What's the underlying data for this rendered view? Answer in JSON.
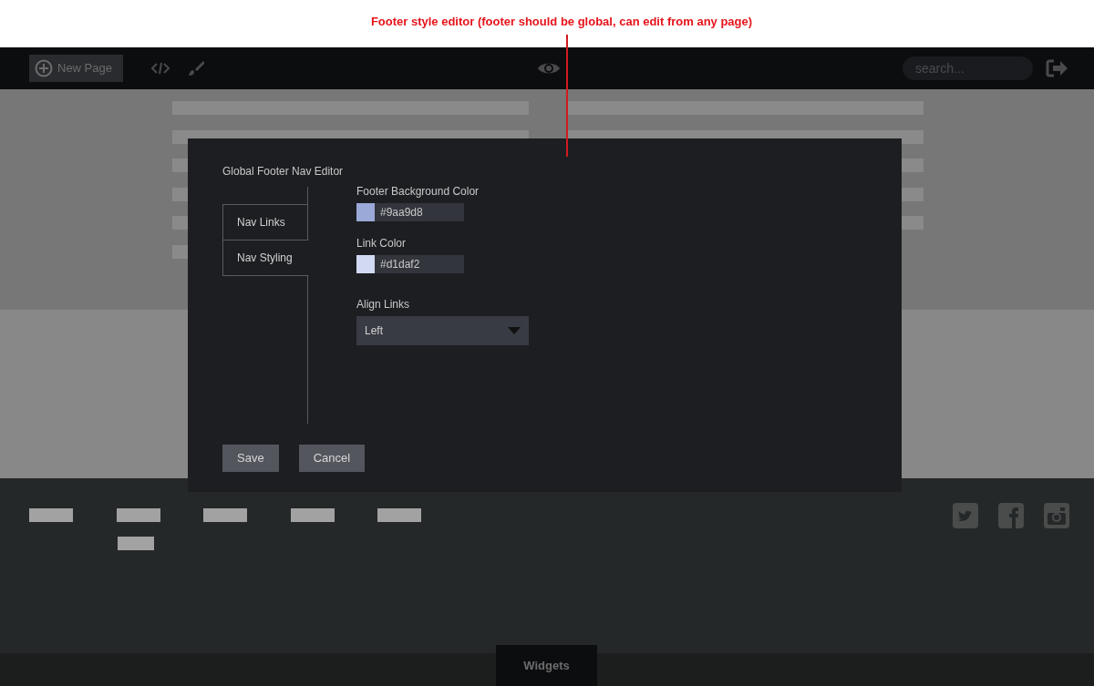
{
  "annotation": "Footer style editor (footer should be global, can edit from any page)",
  "toolbar": {
    "new_page": "New Page",
    "search": {
      "placeholder": "search..."
    }
  },
  "modal": {
    "title": "Global Footer Nav Editor",
    "tabs": [
      {
        "label": "Nav Links",
        "selected": false
      },
      {
        "label": "Nav Styling",
        "selected": true
      }
    ],
    "fields": [
      {
        "kind": "color",
        "label": "Footer Background Color",
        "color": "#9aa9d8",
        "value": "#9aa9d8"
      },
      {
        "kind": "color",
        "label": "Link Color",
        "color": "#d1daf2",
        "value": "#d1daf2"
      },
      {
        "kind": "select",
        "label": "Align Links",
        "value": "Left"
      }
    ],
    "buttons": [
      "Save",
      "Cancel"
    ]
  },
  "bottom_tab": "Widgets"
}
